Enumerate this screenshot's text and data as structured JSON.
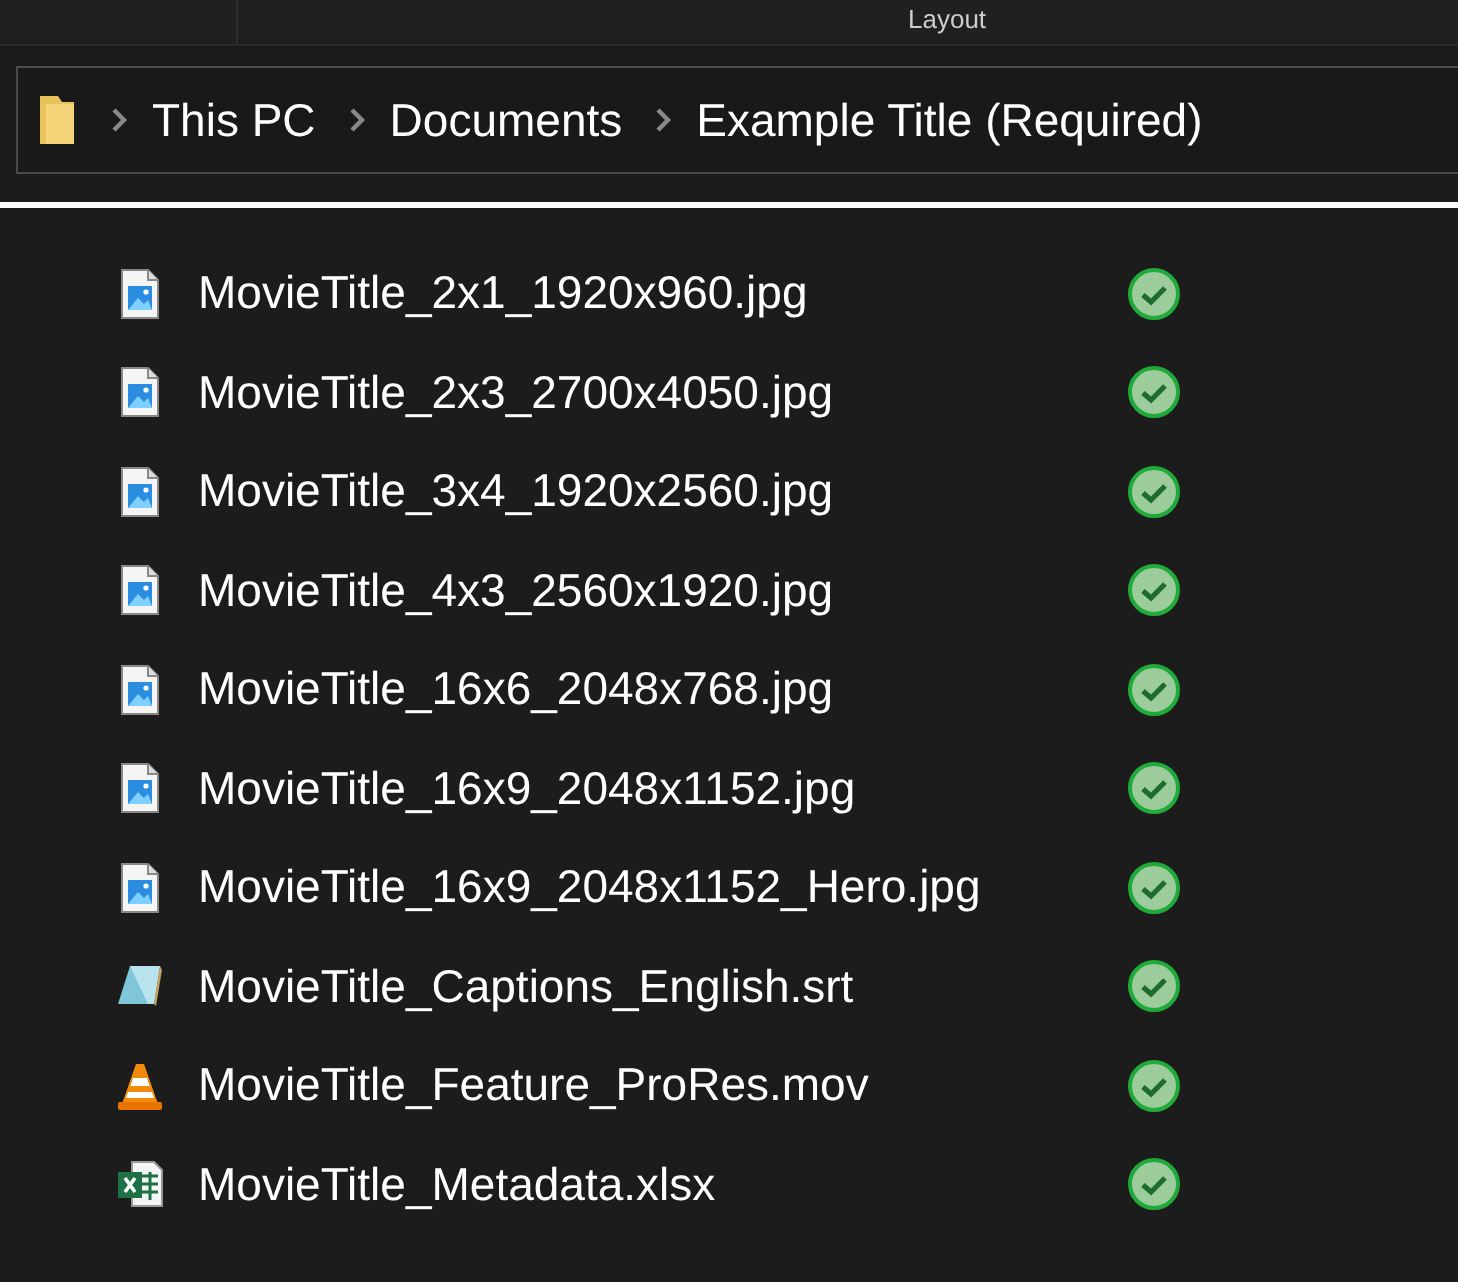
{
  "toolbar": {
    "label": "Layout"
  },
  "breadcrumb": [
    "This PC",
    "Documents",
    "Example Title (Required)"
  ],
  "files": [
    {
      "name": "MovieTitle_2x1_1920x960.jpg",
      "kind": "image",
      "synced": true
    },
    {
      "name": "MovieTitle_2x3_2700x4050.jpg",
      "kind": "image",
      "synced": true
    },
    {
      "name": "MovieTitle_3x4_1920x2560.jpg",
      "kind": "image",
      "synced": true
    },
    {
      "name": "MovieTitle_4x3_2560x1920.jpg",
      "kind": "image",
      "synced": true
    },
    {
      "name": "MovieTitle_16x6_2048x768.jpg",
      "kind": "image",
      "synced": true
    },
    {
      "name": "MovieTitle_16x9_2048x1152.jpg",
      "kind": "image",
      "synced": true
    },
    {
      "name": "MovieTitle_16x9_2048x1152_Hero.jpg",
      "kind": "image",
      "synced": true
    },
    {
      "name": "MovieTitle_Captions_English.srt",
      "kind": "text",
      "synced": true
    },
    {
      "name": "MovieTitle_Feature_ProRes.mov",
      "kind": "video",
      "synced": true
    },
    {
      "name": "MovieTitle_Metadata.xlsx",
      "kind": "spreadsheet",
      "synced": true
    }
  ]
}
